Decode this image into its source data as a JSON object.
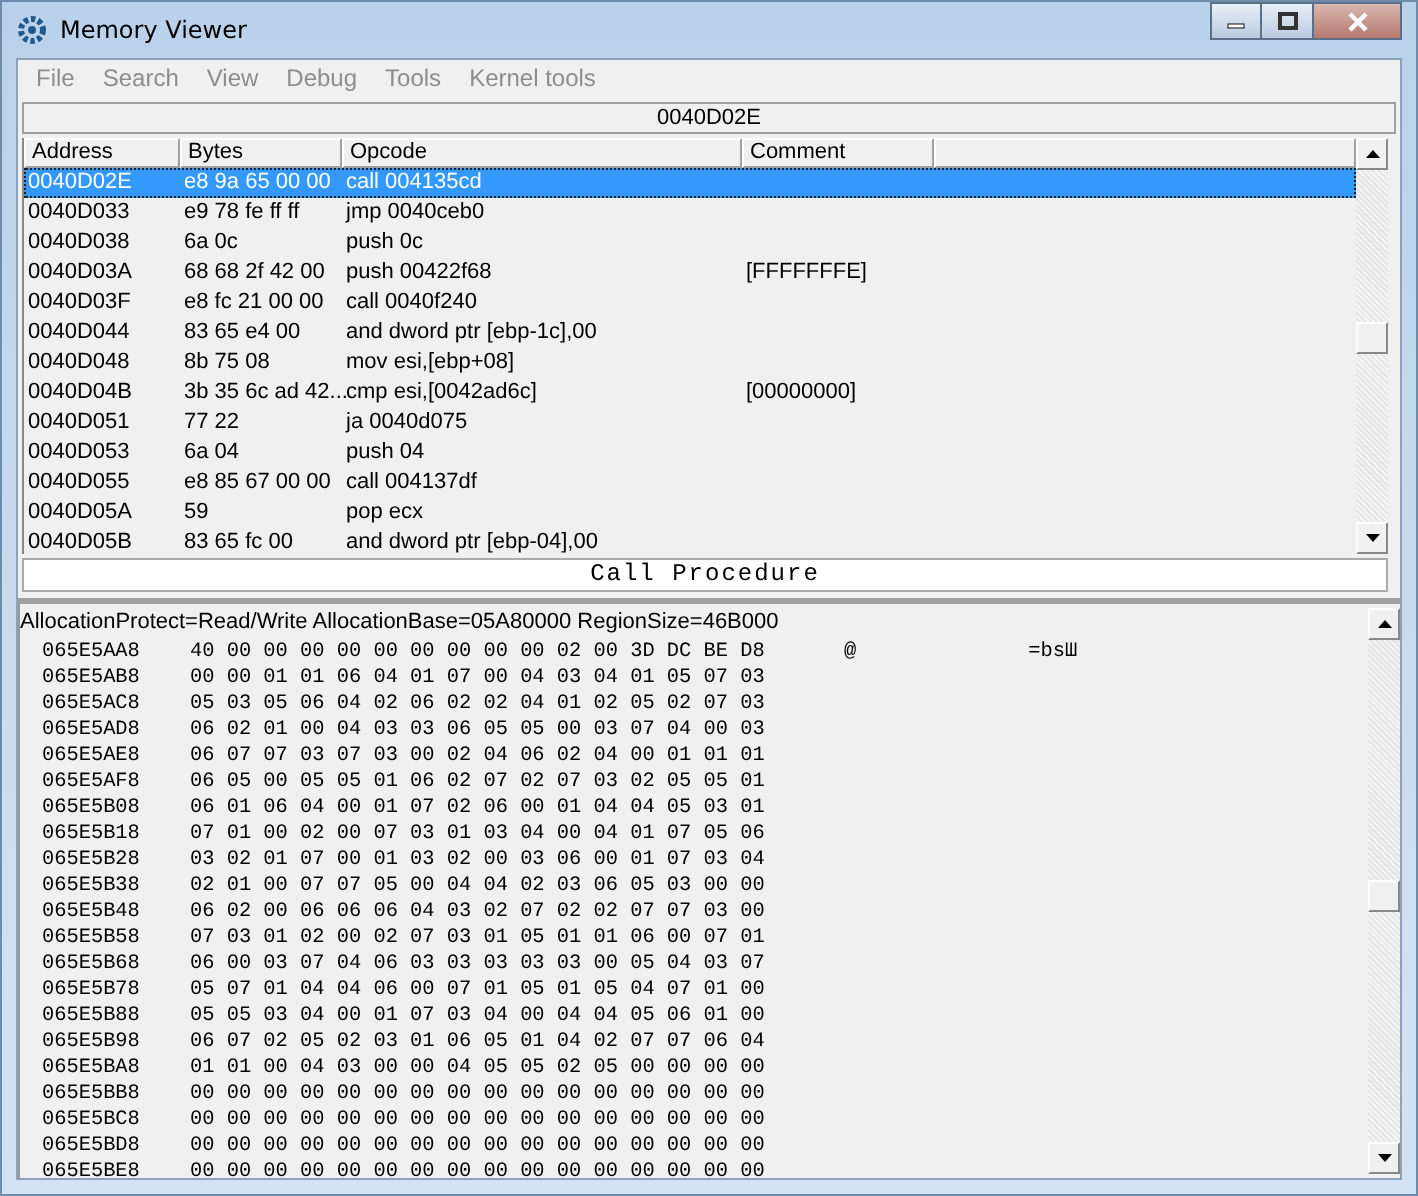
{
  "window": {
    "title": "Memory Viewer"
  },
  "menu": [
    {
      "label": "File",
      "disabled": true
    },
    {
      "label": "Search",
      "disabled": true
    },
    {
      "label": "View",
      "disabled": true
    },
    {
      "label": "Debug",
      "disabled": true
    },
    {
      "label": "Tools",
      "disabled": true
    },
    {
      "label": "Kernel tools",
      "disabled": true
    }
  ],
  "address_bar": "0040D02E",
  "disassembly": {
    "columns": [
      "Address",
      "Bytes",
      "Opcode",
      "Comment"
    ],
    "rows": [
      {
        "address": "0040D02E",
        "bytes": "e8 9a 65 00 00",
        "opcode": "call 004135cd",
        "selected": true
      },
      {
        "address": "0040D033",
        "bytes": "e9 78 fe ff ff",
        "opcode": "jmp 0040ceb0",
        "selected": false
      },
      {
        "address": "0040D038",
        "bytes": "6a 0c",
        "opcode": "push 0c",
        "selected": false
      },
      {
        "address": "0040D03A",
        "bytes": "68 68 2f 42 00",
        "opcode": "push 00422f68",
        "comment": "[FFFFFFFE]",
        "selected": false
      },
      {
        "address": "0040D03F",
        "bytes": "e8 fc 21 00 00",
        "opcode": "call 0040f240",
        "selected": false
      },
      {
        "address": "0040D044",
        "bytes": "83 65 e4 00",
        "opcode": "and dword ptr [ebp-1c],00",
        "selected": false
      },
      {
        "address": "0040D048",
        "bytes": "8b 75 08",
        "opcode": "mov esi,[ebp+08]",
        "selected": false
      },
      {
        "address": "0040D04B",
        "bytes": "3b 35 6c ad 42...",
        "opcode": "cmp esi,[0042ad6c]",
        "comment": "[00000000]",
        "selected": false
      },
      {
        "address": "0040D051",
        "bytes": "77 22",
        "opcode": "ja 0040d075",
        "selected": false
      },
      {
        "address": "0040D053",
        "bytes": "6a 04",
        "opcode": "push 04",
        "selected": false
      },
      {
        "address": "0040D055",
        "bytes": "e8 85 67 00 00",
        "opcode": "call 004137df",
        "selected": false
      },
      {
        "address": "0040D05A",
        "bytes": "59",
        "opcode": "pop ecx",
        "selected": false
      },
      {
        "address": "0040D05B",
        "bytes": "83 65 fc 00",
        "opcode": "and dword ptr [ebp-04],00",
        "selected": false
      }
    ]
  },
  "call_procedure_label": "Call Procedure",
  "hex_view": {
    "info": "AllocationProtect=Read/Write  AllocationBase=05A80000 RegionSize=46B000",
    "rows": [
      {
        "address": "065E5AA8",
        "bytes": "40 00 00 00 00 00 00 00 00 00 02 00 3D DC BE D8",
        "ascii": [
          "@",
          "=bsШ"
        ]
      },
      {
        "address": "065E5AB8",
        "bytes": "00 00 01 01 06 04 01 07 00 04 03 04 01 05 07 03"
      },
      {
        "address": "065E5AC8",
        "bytes": "05 03 05 06 04 02 06 02 02 04 01 02 05 02 07 03"
      },
      {
        "address": "065E5AD8",
        "bytes": "06 02 01 00 04 03 03 06 05 05 00 03 07 04 00 03"
      },
      {
        "address": "065E5AE8",
        "bytes": "06 07 07 03 07 03 00 02 04 06 02 04 00 01 01 01"
      },
      {
        "address": "065E5AF8",
        "bytes": "06 05 00 05 05 01 06 02 07 02 07 03 02 05 05 01"
      },
      {
        "address": "065E5B08",
        "bytes": "06 01 06 04 00 01 07 02 06 00 01 04 04 05 03 01"
      },
      {
        "address": "065E5B18",
        "bytes": "07 01 00 02 00 07 03 01 03 04 00 04 01 07 05 06"
      },
      {
        "address": "065E5B28",
        "bytes": "03 02 01 07 00 01 03 02 00 03 06 00 01 07 03 04"
      },
      {
        "address": "065E5B38",
        "bytes": "02 01 00 07 07 05 00 04 04 02 03 06 05 03 00 00"
      },
      {
        "address": "065E5B48",
        "bytes": "06 02 00 06 06 06 04 03 02 07 02 02 07 07 03 00"
      },
      {
        "address": "065E5B58",
        "bytes": "07 03 01 02 00 02 07 03 01 05 01 01 06 00 07 01"
      },
      {
        "address": "065E5B68",
        "bytes": "06 00 03 07 04 06 03 03 03 03 03 00 05 04 03 07"
      },
      {
        "address": "065E5B78",
        "bytes": "05 07 01 04 04 06 00 07 01 05 01 05 04 07 01 00"
      },
      {
        "address": "065E5B88",
        "bytes": "05 05 03 04 00 01 07 03 04 00 04 04 05 06 01 00"
      },
      {
        "address": "065E5B98",
        "bytes": "06 07 02 05 02 03 01 06 05 01 04 02 07 07 06 04"
      },
      {
        "address": "065E5BA8",
        "bytes": "01 01 00 04 03 00 00 04 05 05 02 05 00 00 00 00"
      },
      {
        "address": "065E5BB8",
        "bytes": "00 00 00 00 00 00 00 00 00 00 00 00 00 00 00 00"
      },
      {
        "address": "065E5BC8",
        "bytes": "00 00 00 00 00 00 00 00 00 00 00 00 00 00 00 00"
      },
      {
        "address": "065E5BD8",
        "bytes": "00 00 00 00 00 00 00 00 00 00 00 00 00 00 00 00"
      },
      {
        "address": "065E5BE8",
        "bytes": "00 00 00 00 00 00 00 00 00 00 00 00 00 00 00 00"
      }
    ]
  }
}
